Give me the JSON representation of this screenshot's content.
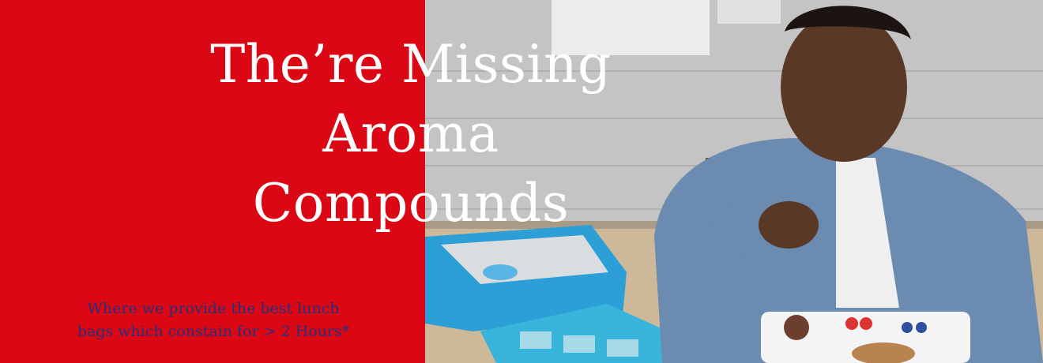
{
  "banner": {
    "headline_lines": [
      "The’re Missing",
      "Aroma",
      "Compounds"
    ],
    "subtext_lines": [
      "Where we provide the best lunch",
      "bags which constain for > 2 Hours*"
    ],
    "colors": {
      "left_panel": "#dc0714",
      "headline": "#ffffff",
      "subtext": "#26307a"
    },
    "photo_icon": "lunch-photo-image"
  }
}
